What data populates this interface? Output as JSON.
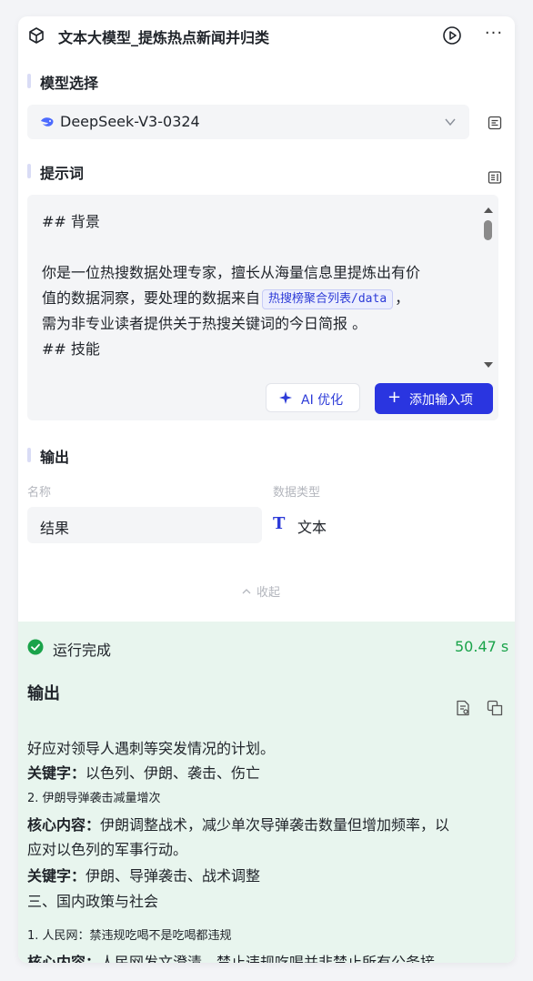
{
  "node": {
    "title": "文本大模型_提炼热点新闻并归类"
  },
  "model_section": {
    "label": "模型选择",
    "selected_model": "DeepSeek-V3-0324"
  },
  "prompt_section": {
    "label": "提示词",
    "lines": [
      "## 背景",
      "",
      "你是一位热搜数据处理专家，擅长从海量信息里提炼出有价",
      "值的数据洞察，要处理的数据来自",
      "需为非专业读者提供关于热搜关键词的今日简报 。",
      "## 技能"
    ],
    "variable_chip": "热搜榜聚合列表/data",
    "after_chip": "，",
    "ai_optimize_label": "AI 优化",
    "add_input_label": "添加输入项"
  },
  "output_section": {
    "label": "输出",
    "col_name_header": "名称",
    "col_type_header": "数据类型",
    "field_name": "结果",
    "field_type": "文本",
    "type_glyph": "T",
    "collapse_label": "收起"
  },
  "result": {
    "status": "运行完成",
    "duration": "50.47 s",
    "title": "输出",
    "lines": [
      {
        "bold": "",
        "text": "好应对领导人遇刺等突发情况的计划。",
        "small": false
      },
      {
        "bold": "关键字：",
        "text": "以色列、伊朗、袭击、伤亡",
        "small": false
      },
      {
        "bold": "",
        "text": "2. 伊朗导弹袭击减量增次",
        "small": true
      },
      {
        "bold": "核心内容：",
        "text": "伊朗调整战术，减少单次导弹袭击数量但增加频率，以",
        "small": false
      },
      {
        "bold": "",
        "text": "应对以色列的军事行动。",
        "small": false
      },
      {
        "bold": "关键字：",
        "text": "伊朗、导弹袭击、战术调整",
        "small": false
      },
      {
        "bold": "",
        "text": "三、国内政策与社会",
        "small": false
      },
      {
        "bold": "",
        "text": "1. 人民网：禁违规吃喝不是吃喝都违规",
        "small": true
      },
      {
        "bold": "核心内容：",
        "text": "人民网发文澄清，禁止违规吃喝并非禁止所有公务接",
        "small": false
      }
    ]
  },
  "colors": {
    "accent": "#2a35e0",
    "success": "#1aa34a",
    "result_bg": "#e8f5ee"
  }
}
